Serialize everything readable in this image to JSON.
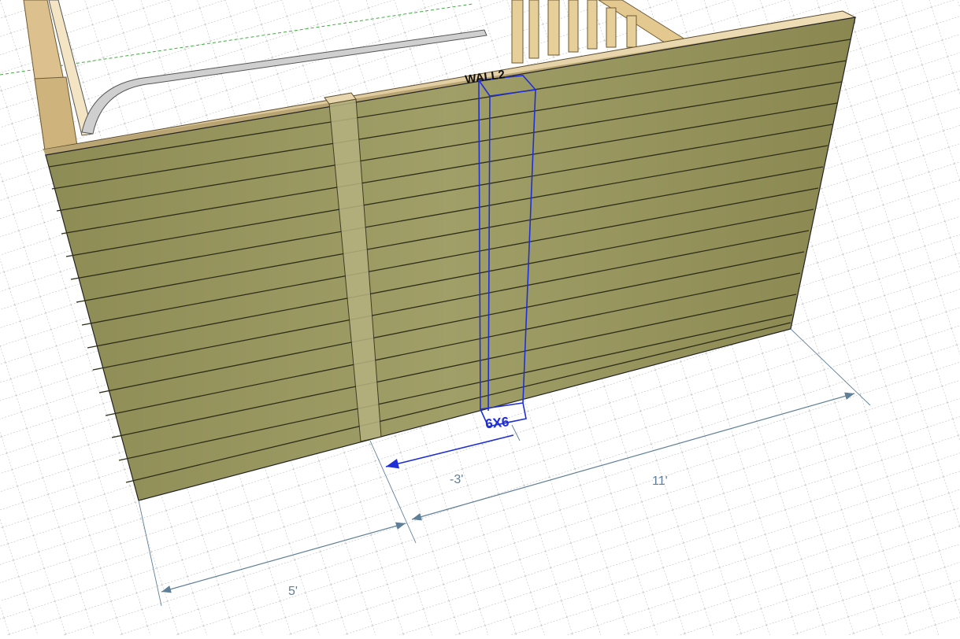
{
  "scene": {
    "wall_label": "WALL2",
    "post_label": "6X6",
    "colors": {
      "siding": "#9c9a62",
      "siding_dark": "#6f6d40",
      "trim": "#e4cfa3",
      "post_outline": "#1f2fd8",
      "dimension": "#5f7f98",
      "grid": "#9a9a9a",
      "background": "#ffffff"
    }
  },
  "dimensions": [
    {
      "id": "offset",
      "label": "-3'"
    },
    {
      "id": "right",
      "label": "11'"
    },
    {
      "id": "left",
      "label": "5'"
    }
  ]
}
